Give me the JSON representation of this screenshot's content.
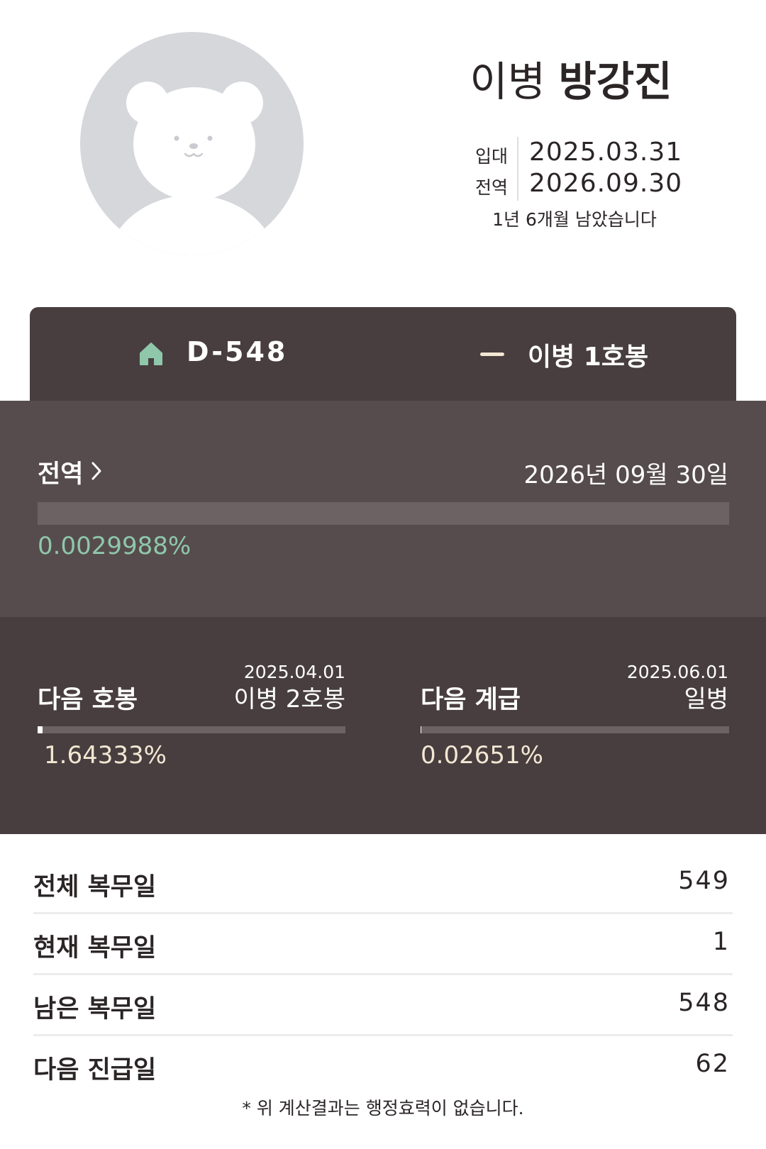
{
  "profile": {
    "rank": "이병",
    "name": "방강진",
    "enlist_label": "입대",
    "enlist_date": "2025.03.31",
    "discharge_label": "전역",
    "discharge_date": "2026.09.30",
    "remaining_text": "1년 6개월 남았습니다",
    "avatar_icon": "bear-avatar-icon"
  },
  "summary": {
    "dday": "D-548",
    "current_rank": "이병 1호봉",
    "home_icon": "home-icon",
    "home_color": "#8fc7aa"
  },
  "discharge": {
    "label": "전역",
    "date_text": "2026년 09월 30일",
    "percent_text": "0.0029988%",
    "progress": 2.9988e-05
  },
  "next_pay": {
    "title": "다음 호봉",
    "date": "2025.04.01",
    "target": "이병 2호봉",
    "percent_text": "1.64333%",
    "progress": 0.0164333
  },
  "next_promotion": {
    "title": "다음 계급",
    "date": "2025.06.01",
    "target": "일병",
    "percent_text": "0.02651%",
    "progress": 0.0002651
  },
  "stats": [
    {
      "label": "전체 복무일",
      "value": "549"
    },
    {
      "label": "현재 복무일",
      "value": "1"
    },
    {
      "label": "남은 복무일",
      "value": "548"
    },
    {
      "label": "다음 진급일",
      "value": "62"
    }
  ],
  "disclaimer": "* 위 계산결과는 행정효력이 없습니다.",
  "colors": {
    "dark_bg": "#483e3f",
    "panel_bg": "#564c4d",
    "accent_green": "#8fc7aa",
    "cream": "#f3e7d3"
  }
}
